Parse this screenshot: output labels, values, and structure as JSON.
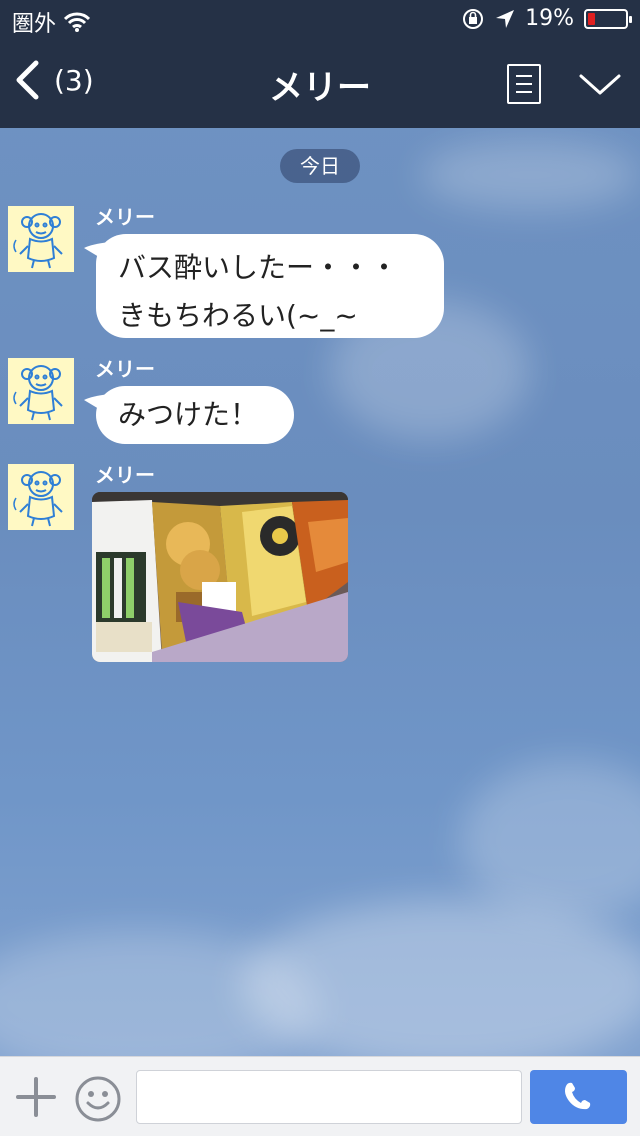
{
  "status_bar": {
    "carrier": "圏外",
    "battery_percent": "19%",
    "battery_level": 0.19,
    "icons": [
      "wifi-icon",
      "rotation-lock-icon",
      "location-arrow-icon",
      "battery-icon"
    ]
  },
  "header": {
    "back_count": "(3)",
    "title": "メリー",
    "icons": [
      "back-chevron-icon",
      "notes-icon",
      "chevron-down-icon"
    ]
  },
  "chat": {
    "date_label": "今日",
    "messages": [
      {
        "sender": "メリー",
        "lines": [
          "バス酔いしたー・・・",
          "きもちわるい(~_~"
        ]
      },
      {
        "sender": "メリー",
        "lines": [
          "みつけた！"
        ]
      },
      {
        "sender": "メリー",
        "type": "photo"
      }
    ]
  },
  "input_bar": {
    "placeholder": "",
    "icons": [
      "plus-icon",
      "smiley-icon",
      "phone-icon"
    ]
  },
  "colors": {
    "header_bg": "#253146",
    "chat_bg": "#6f93c3",
    "call_button": "#4f86e6",
    "battery_low": "#e02020"
  }
}
